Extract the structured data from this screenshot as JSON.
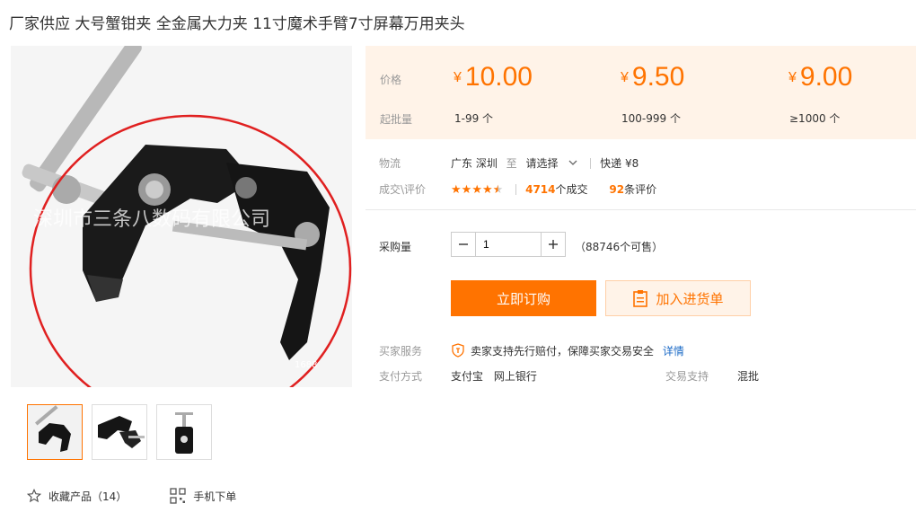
{
  "title": "厂家供应 大号蟹钳夹 全金属大力夹 11寸魔术手臂7寸屏幕万用夹头",
  "gallery": {
    "watermark": "深圳市三条八数码有限公司",
    "corner_mark": "1688",
    "thumb_count": 3
  },
  "actions": {
    "favorite_label": "收藏产品（14）",
    "mobile_label": "手机下单"
  },
  "price_box": {
    "price_label": "价格",
    "moq_label": "起批量",
    "currency": "¥",
    "tiers": [
      {
        "price": "10.00",
        "range": "1-99 个"
      },
      {
        "price": "9.50",
        "range": "100-999 个"
      },
      {
        "price": "9.00",
        "range": "≥1000 个"
      }
    ]
  },
  "logistics": {
    "label": "物流",
    "origin": "广东 深圳",
    "to": "至",
    "destination": "请选择",
    "shipping": "快递 ¥8"
  },
  "deals": {
    "label": "成交\\评价",
    "rating": 4.5,
    "deal_count": "4714",
    "deal_suffix": "个成交",
    "review_count": "92",
    "review_suffix": "条评价"
  },
  "purchase": {
    "label": "采购量",
    "quantity": "1",
    "stock": "（88746个可售）"
  },
  "buttons": {
    "buy": "立即订购",
    "add_cart": "加入进货单"
  },
  "service": {
    "label": "买家服务",
    "text": "卖家支持先行赔付，保障买家交易安全",
    "link": "详情"
  },
  "payment": {
    "label": "支付方式",
    "methods": [
      "支付宝",
      "网上银行"
    ],
    "trade_label": "交易支持",
    "trade_value": "混批"
  },
  "colors": {
    "accent": "#ff7300",
    "price_bg": "#fff3e8",
    "link": "#1c6bc7",
    "circle": "#e02020"
  },
  "icons": [
    "star-outline-icon",
    "qr-code-icon",
    "chevron-down-icon",
    "clipboard-icon",
    "shield-badge-icon",
    "minus-icon",
    "plus-icon"
  ]
}
